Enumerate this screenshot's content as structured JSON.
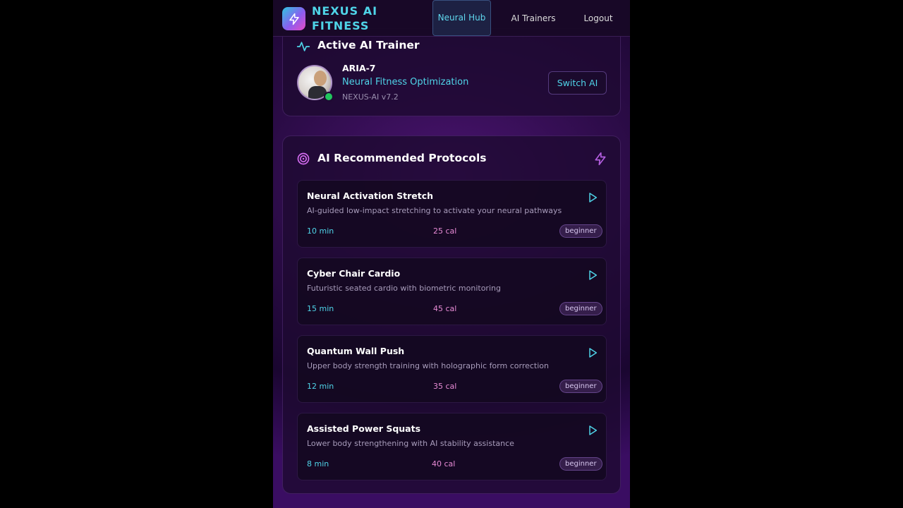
{
  "header": {
    "brand": "NEXUS AI FITNESS",
    "nav": {
      "neural_hub": "Neural Hub",
      "ai_trainers": "AI Trainers",
      "logout": "Logout"
    }
  },
  "active_trainer": {
    "title": "Active AI Trainer",
    "name": "ARIA-7",
    "specialty": "Neural Fitness Optimization",
    "version": "NEXUS-AI v7.2",
    "status": "online",
    "switch_label": "Switch AI"
  },
  "protocols": {
    "title": "AI Recommended Protocols",
    "items": [
      {
        "name": "Neural Activation Stretch",
        "description": "AI-guided low-impact stretching to activate your neural pathways",
        "duration": "10 min",
        "calories": "25 cal",
        "level": "beginner"
      },
      {
        "name": "Cyber Chair Cardio",
        "description": "Futuristic seated cardio with biometric monitoring",
        "duration": "15 min",
        "calories": "45 cal",
        "level": "beginner"
      },
      {
        "name": "Quantum Wall Push",
        "description": "Upper body strength training with holographic form correction",
        "duration": "12 min",
        "calories": "35 cal",
        "level": "beginner"
      },
      {
        "name": "Assisted Power Squats",
        "description": "Lower body strengthening with AI stability assistance",
        "duration": "8 min",
        "calories": "40 cal",
        "level": "beginner"
      }
    ]
  },
  "icons": {
    "brand": "lightning-bolt-icon",
    "trainer_section": "pulse-icon",
    "protocols_section": "target-icon",
    "protocols_action": "lightning-bolt-icon",
    "start": "play-icon"
  },
  "colors": {
    "accent_cyan": "#4fd4e8",
    "accent_pink": "#e68ad4",
    "online": "#22c55e",
    "background": "#2a0b45"
  }
}
